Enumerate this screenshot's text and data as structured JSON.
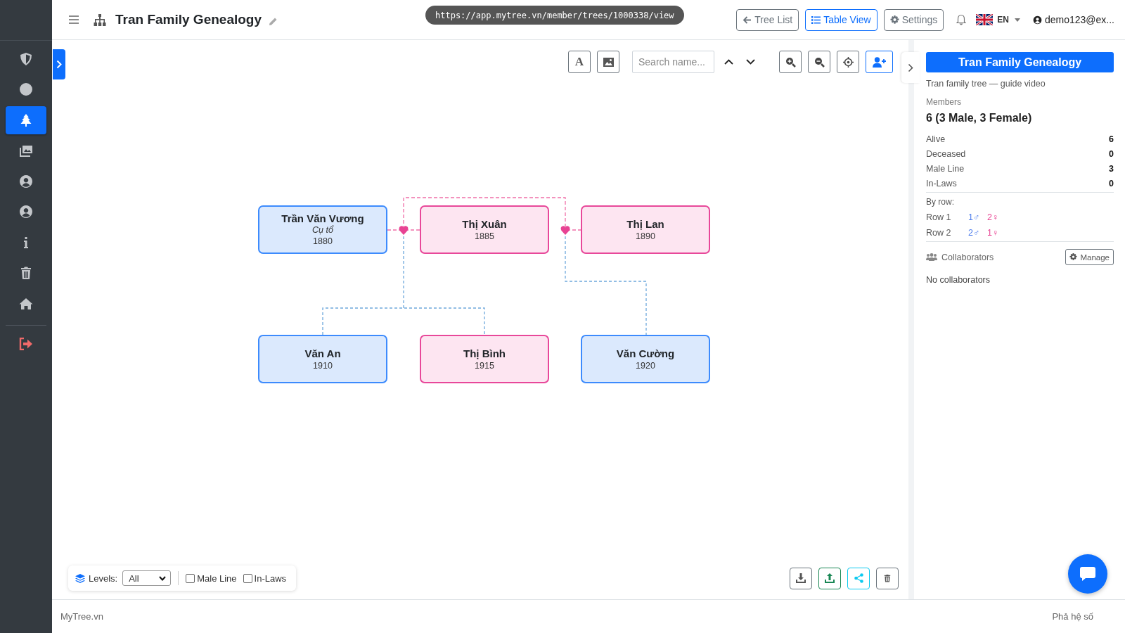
{
  "sidebar": {
    "items": [
      {
        "kind": "shield",
        "selected": false
      },
      {
        "kind": "circle",
        "selected": false
      },
      {
        "kind": "tree",
        "selected": true
      },
      {
        "kind": "images",
        "selected": false
      },
      {
        "kind": "user",
        "selected": false
      },
      {
        "kind": "user",
        "selected": false
      },
      {
        "kind": "info",
        "selected": false
      },
      {
        "kind": "trash",
        "selected": false
      },
      {
        "kind": "home",
        "selected": false
      }
    ]
  },
  "header": {
    "title": "Tran Family Genealogy",
    "url_tooltip": "https://app.mytree.vn/member/trees/1000338/view",
    "buttons": [
      {
        "label": "Tree List",
        "kind": "back",
        "selected": false
      },
      {
        "label": "Table View",
        "kind": "list",
        "selected": true
      },
      {
        "label": "Settings",
        "kind": "gear",
        "selected": false
      }
    ],
    "language": "EN",
    "user": "demo123@ex..."
  },
  "toolbar": {
    "search": {
      "placeholder": "Search name..."
    },
    "text_button": "A"
  },
  "tree": {
    "rows": [
      [
        {
          "name": "Trần Văn Vương",
          "note": "Cụ tổ",
          "year": "1880",
          "kind": "male"
        },
        {
          "name": "Thị Xuân",
          "year": "1885",
          "kind": "female"
        },
        {
          "name": "Thị Lan",
          "year": "1890",
          "kind": "female"
        }
      ],
      [
        {
          "name": "Văn An",
          "year": "1910",
          "kind": "male"
        },
        {
          "name": "Thị Bình",
          "year": "1915",
          "kind": "female"
        },
        {
          "name": "Văn Cường",
          "year": "1920",
          "kind": "male"
        }
      ]
    ]
  },
  "panel": {
    "title": "Tran Family Genealogy",
    "subtitle": "Tran family tree — guide video",
    "members_label": "Members",
    "members": "6 (3 Male, 3 Female)",
    "stats": [
      {
        "label": "Alive",
        "value": "6"
      },
      {
        "label": "Deceased",
        "value": "0"
      },
      {
        "label": "Male Line",
        "value": "3"
      },
      {
        "label": "In-Laws",
        "value": "0"
      }
    ],
    "by_row_label": "By row:",
    "rows": [
      {
        "label": "Row 1",
        "male": "1♂",
        "female": "2♀"
      },
      {
        "label": "Row 2",
        "male": "2♂",
        "female": "1♀"
      }
    ],
    "collaborators_label": "Collaborators",
    "manage": "Manage",
    "collaborators_empty": "No collaborators"
  },
  "controls": {
    "levels_label": "Levels:",
    "level": "All",
    "checkboxes": [
      {
        "label": "Male Line",
        "checked": false
      },
      {
        "label": "In-Laws",
        "checked": false
      }
    ]
  },
  "footer": {
    "left": "MyTree.vn",
    "right": "Phả hệ số"
  }
}
